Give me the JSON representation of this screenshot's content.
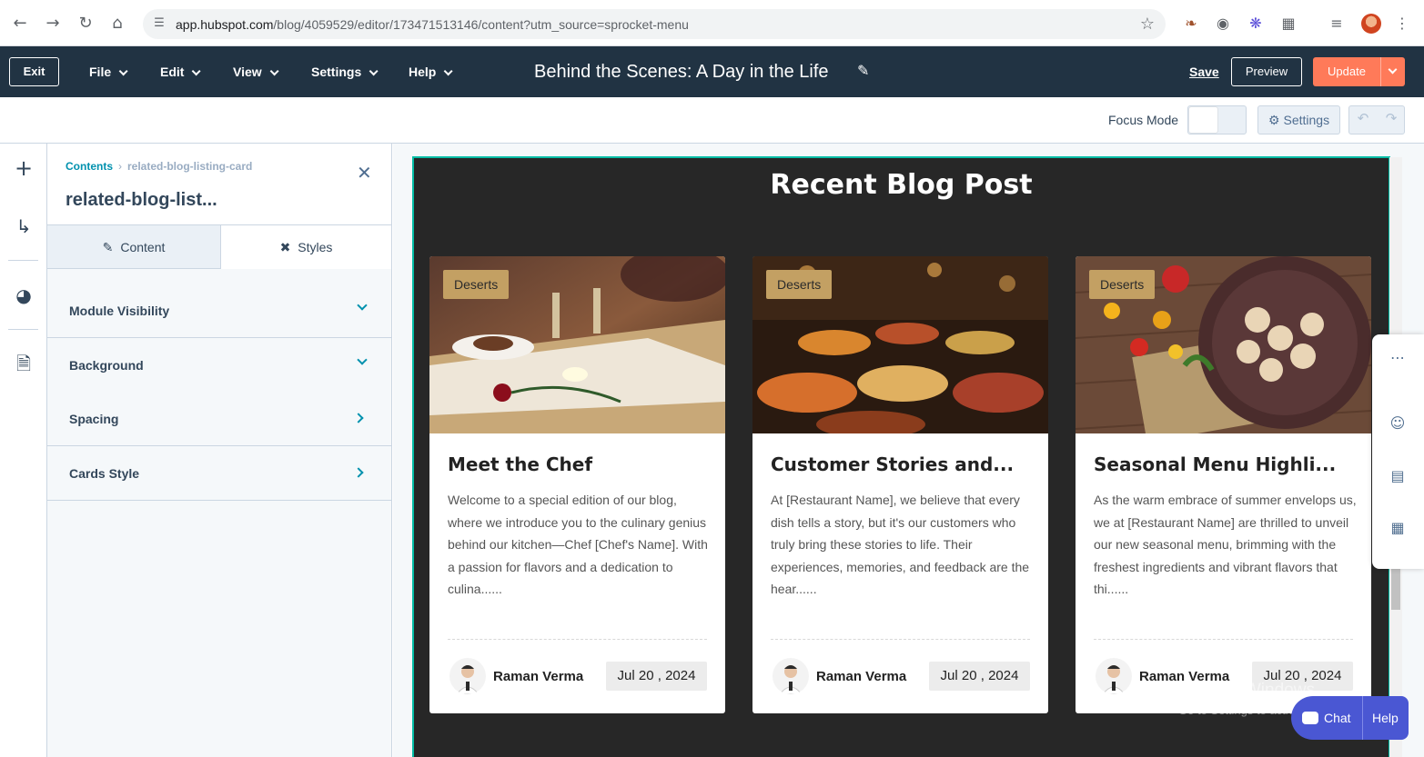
{
  "browser": {
    "url_main": "app.hubspot.com",
    "url_path": "/blog/4059529/editor/173471513146/content?utm_source=sprocket-menu"
  },
  "header": {
    "exit_label": "Exit",
    "menus": [
      "File",
      "Edit",
      "View",
      "Settings",
      "Help"
    ],
    "doc_title": "Behind the Scenes: A Day in the Life",
    "save_label": "Save",
    "preview_label": "Preview",
    "update_label": "Update",
    "accent_color": "#ff7a59"
  },
  "toolbar": {
    "focus_mode_label": "Focus Mode",
    "settings_label": "Settings"
  },
  "panel": {
    "breadcrumb_root": "Contents",
    "breadcrumb_current": "related-blog-listing-card",
    "title": "related-blog-list...",
    "tabs": [
      "Content",
      "Styles"
    ],
    "sections": [
      {
        "label": "Module Visibility",
        "state": "expandable"
      },
      {
        "label": "Background",
        "state": "expandable"
      },
      {
        "label": "Spacing",
        "state": "navigable"
      },
      {
        "label": "Cards Style",
        "state": "navigable"
      }
    ]
  },
  "page": {
    "section_title": "Recent Blog Post",
    "cards": [
      {
        "tag": "Deserts",
        "title": "Meet the Chef",
        "excerpt": "Welcome to a special edition of our blog, where we introduce you to the culinary genius behind our kitchen—Chef [Chef's Name]. With a passion for flavors and a dedication to culina......",
        "author": "Raman Verma",
        "date": "Jul 20 , 2024"
      },
      {
        "tag": "Deserts",
        "title": "Customer Stories and...",
        "excerpt": "At [Restaurant Name], we believe that every dish tells a story, but it's our customers who truly bring these stories to life. Their experiences, memories, and feedback are the hear......",
        "author": "Raman Verma",
        "date": "Jul 20 , 2024"
      },
      {
        "tag": "Deserts",
        "title": "Seasonal Menu Highli...",
        "excerpt": "As the warm embrace of summer envelops us, we at [Restaurant Name] are thrilled to unveil our new seasonal menu, brimming with the freshest ingredients and vibrant flavors that thi......",
        "author": "Raman Verma",
        "date": "Jul 20 , 2024"
      }
    ]
  },
  "overlay": {
    "watermark_line1": "Activate Windows",
    "watermark_line2": "Go to Settings to activate Windows.",
    "chat_label": "Chat",
    "help_label": "Help"
  }
}
